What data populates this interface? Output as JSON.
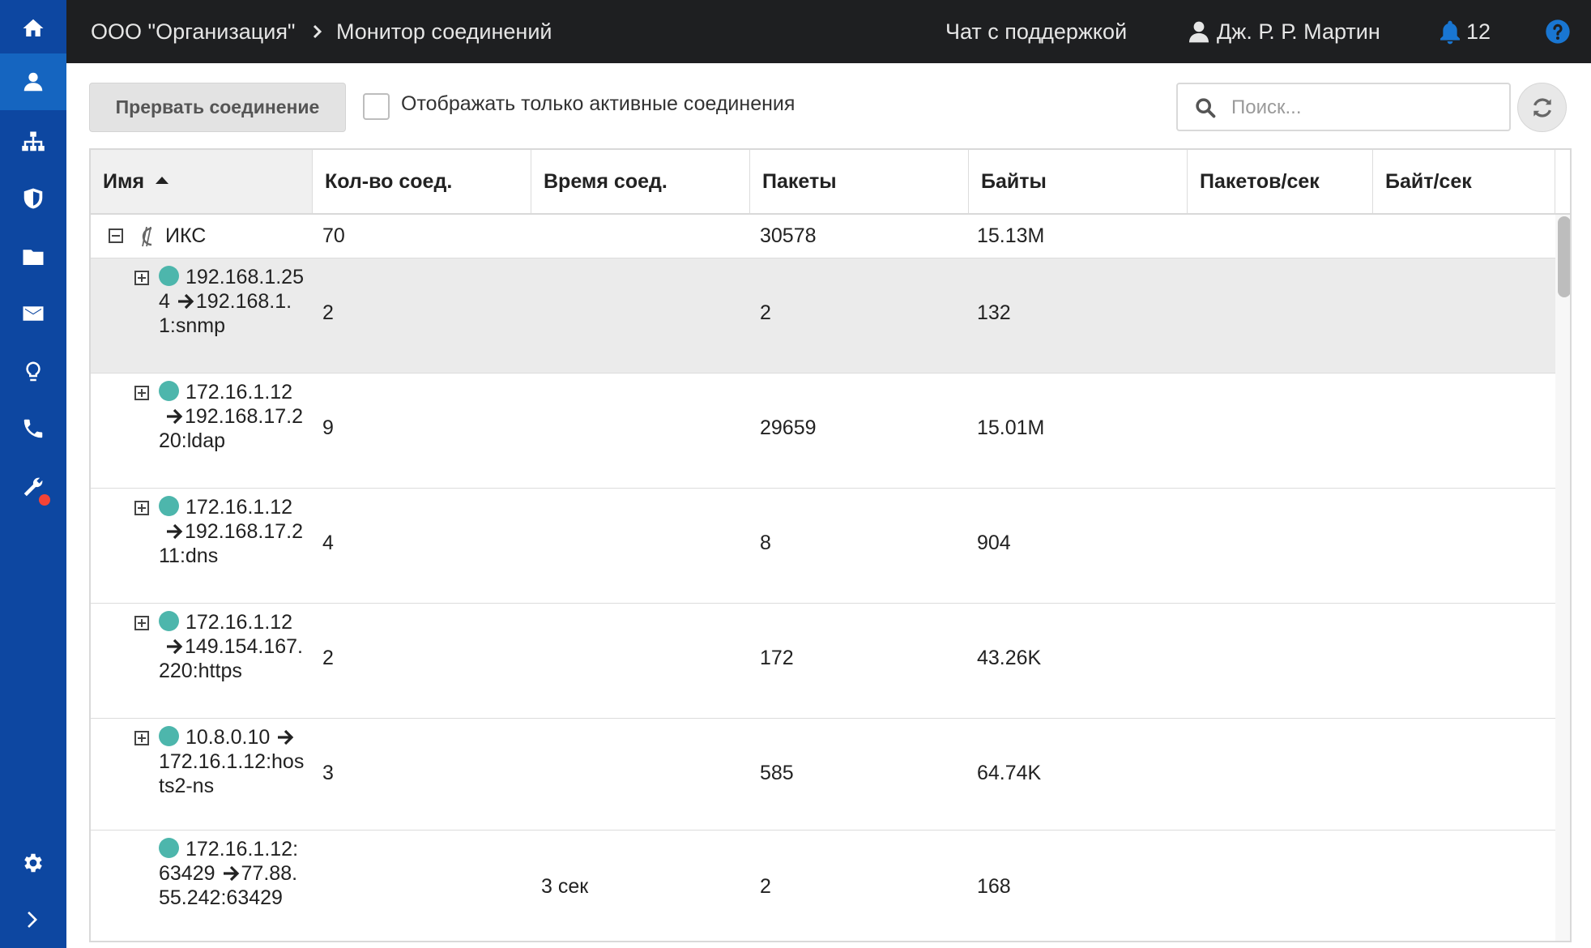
{
  "sidebar": {
    "items": [
      {
        "icon": "home-icon"
      },
      {
        "icon": "user-icon",
        "active": true
      },
      {
        "icon": "network-icon"
      },
      {
        "icon": "shield-icon"
      },
      {
        "icon": "folder-icon"
      },
      {
        "icon": "mail-icon"
      },
      {
        "icon": "lightbulb-icon"
      },
      {
        "icon": "phone-icon"
      },
      {
        "icon": "wrench-icon",
        "notification_dot": true
      },
      {
        "icon": "gear-icon"
      },
      {
        "icon": "chevron-right-icon"
      }
    ],
    "accent_color": "#0d47a1"
  },
  "header": {
    "breadcrumb_org": "ООО \"Организация\"",
    "breadcrumb_page": "Монитор соединений",
    "support_chat": "Чат с поддержкой",
    "user_name": "Дж. Р. Р. Мартин",
    "notifications_count": "12"
  },
  "toolbar": {
    "break_button": "Прервать соединение",
    "active_only_label": "Отображать только активные соединения",
    "active_only_checked": false,
    "search_placeholder": "Поиск..."
  },
  "table": {
    "columns": [
      "Имя",
      "Кол-во соед.",
      "Время соед.",
      "Пакеты",
      "Байты",
      "Пакетов/сек",
      "Байт/сек"
    ],
    "sorted_column": "Имя",
    "sort_direction": "asc",
    "root": {
      "name": "ИКС",
      "expanded": true,
      "connections": "70",
      "time": "",
      "packets": "30578",
      "bytes": "15.13M"
    },
    "rows": [
      {
        "src": "192.168.1.254",
        "dst": "192.168.1.1:snmp",
        "connections": "2",
        "time": "",
        "packets": "2",
        "bytes": "132",
        "selected": true,
        "expandable": true
      },
      {
        "src": "172.16.1.12",
        "dst": "192.168.17.220:ldap",
        "connections": "9",
        "time": "",
        "packets": "29659",
        "bytes": "15.01M",
        "expandable": true
      },
      {
        "src": "172.16.1.12",
        "dst": "192.168.17.211:dns",
        "connections": "4",
        "time": "",
        "packets": "8",
        "bytes": "904",
        "expandable": true
      },
      {
        "src": "172.16.1.12",
        "dst": "149.154.167.220:https",
        "connections": "2",
        "time": "",
        "packets": "172",
        "bytes": "43.26K",
        "expandable": true
      },
      {
        "src": "10.8.0.10",
        "dst": "172.16.1.12:hosts2-ns",
        "connections": "3",
        "time": "",
        "packets": "585",
        "bytes": "64.74K",
        "expandable": true
      },
      {
        "src": "172.16.1.12:63429",
        "dst": "77.88.55.242:63429",
        "connections": "",
        "time": "3 сек",
        "packets": "2",
        "bytes": "168",
        "expandable": false
      }
    ],
    "status_color": "#4db6ac"
  }
}
